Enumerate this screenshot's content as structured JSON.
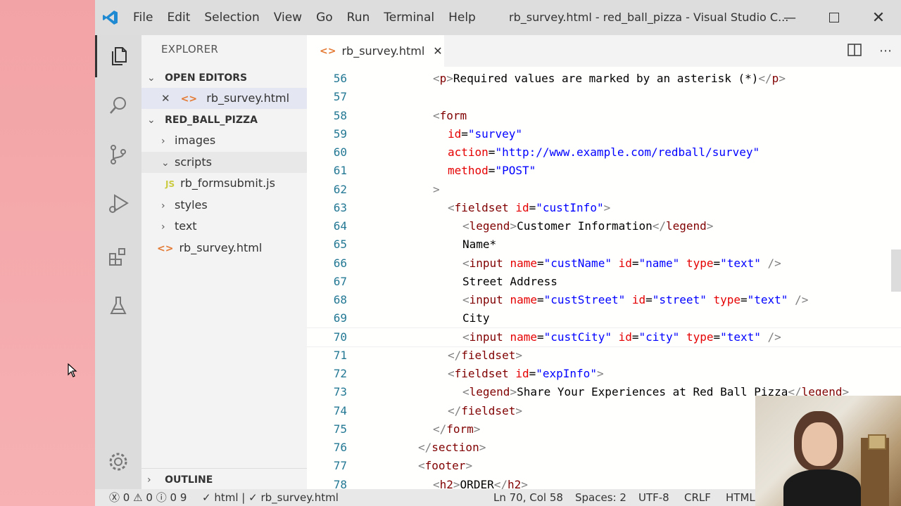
{
  "menu": [
    "File",
    "Edit",
    "Selection",
    "View",
    "Go",
    "Run",
    "Terminal",
    "Help"
  ],
  "window_title": "rb_survey.html - red_ball_pizza - Visual Studio C...",
  "sidebar": {
    "title": "EXPLORER",
    "open_editors_label": "OPEN EDITORS",
    "open_editor_file": "rb_survey.html",
    "project_label": "RED_BALL_PIZZA",
    "tree": [
      {
        "label": "images",
        "type": "folder",
        "expanded": false
      },
      {
        "label": "scripts",
        "type": "folder",
        "expanded": true
      },
      {
        "label": "rb_formsubmit.js",
        "type": "js"
      },
      {
        "label": "styles",
        "type": "folder",
        "expanded": false
      },
      {
        "label": "text",
        "type": "folder",
        "expanded": false
      },
      {
        "label": "rb_survey.html",
        "type": "html"
      }
    ],
    "outline_label": "OUTLINE"
  },
  "tab": {
    "label": "rb_survey.html"
  },
  "code_lines": [
    {
      "n": "56",
      "html": "<span class='p'>&lt;</span><span class='t'>p</span><span class='p'>&gt;</span><span class='x'>Required values are marked by an asterisk (*)</span><span class='p'>&lt;/</span><span class='t'>p</span><span class='p'>&gt;</span>",
      "indent": 1
    },
    {
      "n": "57",
      "html": "",
      "indent": 0
    },
    {
      "n": "58",
      "html": "<span class='p'>&lt;</span><span class='t'>form</span>",
      "indent": 1
    },
    {
      "n": "59",
      "html": "<span class='a'>id</span><span class='x'>=</span><span class='v'>\"survey\"</span>",
      "indent": 2
    },
    {
      "n": "60",
      "html": "<span class='a'>action</span><span class='x'>=</span><span class='v'>\"http://www.example.com/redball/survey\"</span>",
      "indent": 2
    },
    {
      "n": "61",
      "html": "<span class='a'>method</span><span class='x'>=</span><span class='v'>\"POST\"</span>",
      "indent": 2
    },
    {
      "n": "62",
      "html": "<span class='p'>&gt;</span>",
      "indent": 1
    },
    {
      "n": "63",
      "html": "<span class='p'>&lt;</span><span class='t'>fieldset</span> <span class='a'>id</span><span class='x'>=</span><span class='v'>\"custInfo\"</span><span class='p'>&gt;</span>",
      "indent": 2
    },
    {
      "n": "64",
      "html": "<span class='p'>&lt;</span><span class='t'>legend</span><span class='p'>&gt;</span><span class='x'>Customer Information</span><span class='p'>&lt;/</span><span class='t'>legend</span><span class='p'>&gt;</span>",
      "indent": 3
    },
    {
      "n": "65",
      "html": "<span class='x'>Name*</span>",
      "indent": 3
    },
    {
      "n": "66",
      "html": "<span class='p'>&lt;</span><span class='t'>input</span> <span class='a'>name</span><span class='x'>=</span><span class='v'>\"custName\"</span> <span class='a'>id</span><span class='x'>=</span><span class='v'>\"name\"</span> <span class='a'>type</span><span class='x'>=</span><span class='v'>\"text\"</span> <span class='p'>/&gt;</span>",
      "indent": 3
    },
    {
      "n": "67",
      "html": "<span class='x'>Street Address</span>",
      "indent": 3
    },
    {
      "n": "68",
      "html": "<span class='p'>&lt;</span><span class='t'>input</span> <span class='a'>name</span><span class='x'>=</span><span class='v'>\"custStreet\"</span> <span class='a'>id</span><span class='x'>=</span><span class='v'>\"street\"</span> <span class='a'>type</span><span class='x'>=</span><span class='v'>\"text\"</span> <span class='p'>/&gt;</span>",
      "indent": 3
    },
    {
      "n": "69",
      "html": "<span class='x'>City</span>",
      "indent": 3
    },
    {
      "n": "70",
      "html": "<span class='p'>&lt;</span><span class='t'>input</span> <span class='a'>name</span><span class='x'>=</span><span class='v'>\"custCity\"</span> <span class='a'>id</span><span class='x'>=</span><span class='v'>\"city\"</span> <span class='a'>type</span><span class='x'>=</span><span class='v'>\"text\"</span> <span class='p'>/&gt;</span>",
      "indent": 3,
      "current": true
    },
    {
      "n": "71",
      "html": "<span class='p'>&lt;/</span><span class='t'>fieldset</span><span class='p'>&gt;</span>",
      "indent": 2
    },
    {
      "n": "72",
      "html": "<span class='p'>&lt;</span><span class='t'>fieldset</span> <span class='a'>id</span><span class='x'>=</span><span class='v'>\"expInfo\"</span><span class='p'>&gt;</span>",
      "indent": 2
    },
    {
      "n": "73",
      "html": "<span class='p'>&lt;</span><span class='t'>legend</span><span class='p'>&gt;</span><span class='x'>Share Your Experiences at Red Ball Pizza</span><span class='p'>&lt;/</span><span class='t'>legend</span><span class='p'>&gt;</span>",
      "indent": 3
    },
    {
      "n": "74",
      "html": "<span class='p'>&lt;/</span><span class='t'>fieldset</span><span class='p'>&gt;</span>",
      "indent": 2
    },
    {
      "n": "75",
      "html": "<span class='p'>&lt;/</span><span class='t'>form</span><span class='p'>&gt;</span>",
      "indent": 1
    },
    {
      "n": "76",
      "html": "<span class='p'>&lt;/</span><span class='t'>section</span><span class='p'>&gt;</span>",
      "indent": 0
    },
    {
      "n": "77",
      "html": "<span class='p'>&lt;</span><span class='t'>footer</span><span class='p'>&gt;</span>",
      "indent": 0
    },
    {
      "n": "78",
      "html": "<span class='p'>&lt;</span><span class='t'>h2</span><span class='p'>&gt;</span><span class='x'>ORDER</span><span class='p'>&lt;/</span><span class='t'>h2</span><span class='p'>&gt;</span>",
      "indent": 1
    }
  ],
  "status": {
    "errors": "0",
    "warnings": "0",
    "info": "0",
    "other": "9",
    "html_check": "html",
    "file_check": "rb_survey.html",
    "position": "Ln 70, Col 58",
    "spaces": "Spaces: 2",
    "encoding": "UTF-8",
    "eol": "CRLF",
    "language": "HTML"
  }
}
